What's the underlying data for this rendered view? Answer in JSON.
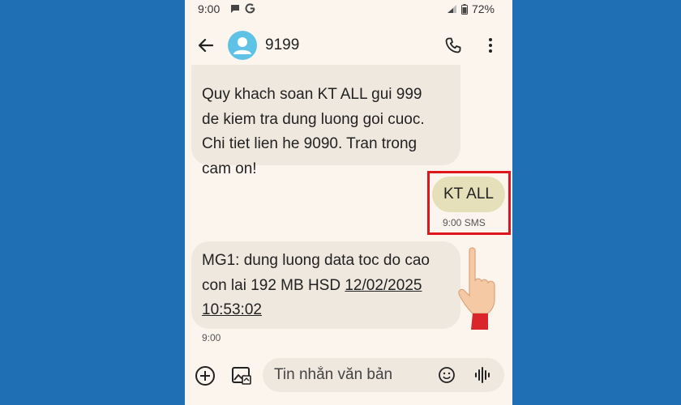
{
  "status_bar": {
    "time": "9:00",
    "battery": "72%"
  },
  "conversation": {
    "contact_name": "9199"
  },
  "messages": {
    "incoming_1": {
      "lines": [
        "Quy khach soan KT ALL gui 999",
        "de kiem tra dung luong goi cuoc.",
        "Chi tiet lien he 9090. Tran trong",
        "cam on!"
      ]
    },
    "outgoing_1": {
      "text": "KT ALL",
      "meta": "9:00 SMS"
    },
    "incoming_2": {
      "line_1": "MG1: dung luong data toc do cao",
      "line_2_prefix": "con lai 192 MB HSD ",
      "date": "12/02/2025",
      "time": "10:53:02",
      "meta": "9:00"
    }
  },
  "composer": {
    "placeholder": "Tin nhắn văn bản"
  },
  "colors": {
    "background": "#1f6fb5",
    "phone_bg": "#fbf5ee",
    "incoming_bubble": "#efe8df",
    "outgoing_bubble": "#e5dfba",
    "highlight": "#e0161d",
    "avatar": "#5ec1e6"
  },
  "icons": {
    "status": [
      "chat-icon",
      "google-icon",
      "signal-icon",
      "battery-icon"
    ],
    "app_bar": [
      "back-arrow-icon",
      "person-icon",
      "phone-icon",
      "more-vertical-icon"
    ],
    "composer": [
      "add-circle-icon",
      "gallery-icon",
      "emoji-icon",
      "voice-icon"
    ],
    "annotation": [
      "pointing-hand-icon"
    ]
  }
}
